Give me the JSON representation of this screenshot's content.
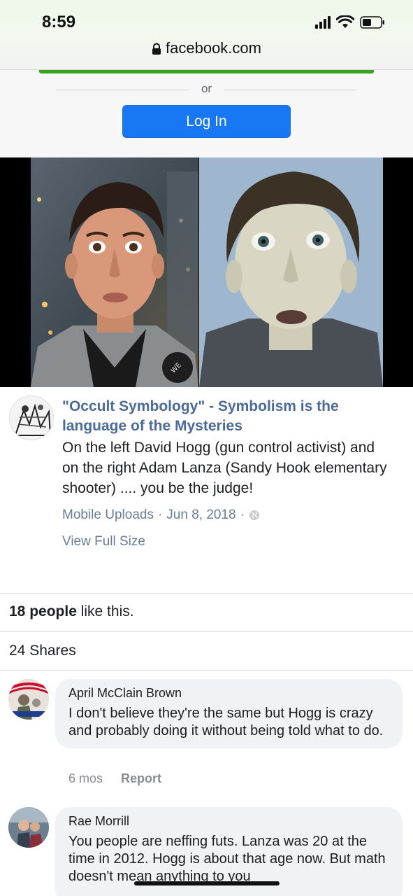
{
  "status_bar": {
    "time": "8:59"
  },
  "browser": {
    "url": "facebook.com"
  },
  "login_prompt": {
    "or_label": "or",
    "login_label": "Log In"
  },
  "post": {
    "title": "\"Occult Symbology\" - Symbolism is the language of the Mysteries",
    "text": "On the left David Hogg (gun control activist) and on the right Adam Lanza (Sandy Hook elementary shooter) .... you be the judge!",
    "album": "Mobile Uploads",
    "separator": "·",
    "date": "Jun 8, 2018",
    "view_full_size": "View Full Size"
  },
  "engagement": {
    "likes_count": "18 people",
    "likes_suffix": " like this.",
    "shares": "24 Shares"
  },
  "comments": [
    {
      "name": "April McClain Brown",
      "text": "I don't believe they're the same but Hogg is crazy and probably doing it without being told what to do.",
      "age": "6 mos",
      "report": "Report"
    },
    {
      "name": "Rae Morrill",
      "text": "You people are neffing futs. Lanza was 20 at the time in 2012. Hogg is about that age now. But math doesn't mean anything to you"
    }
  ],
  "colors": {
    "login_button": "#1877f2",
    "link_blue": "#4b6a9b",
    "meta_gray": "#6b7c99",
    "green_accent": "#36a420"
  }
}
